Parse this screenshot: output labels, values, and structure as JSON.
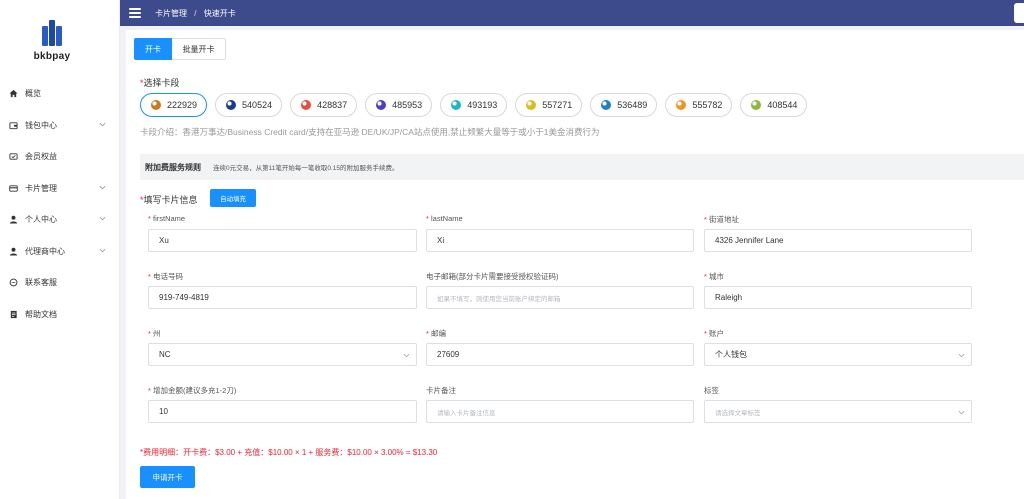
{
  "brand": {
    "logo_text": "bkbpay",
    "accent": "#1890ff",
    "topbar_color": "#3d4a8c"
  },
  "sidebar": {
    "items": [
      {
        "label": "概览",
        "icon": "home-icon",
        "has_submenu": false
      },
      {
        "label": "钱包中心",
        "icon": "wallet-icon",
        "has_submenu": true
      },
      {
        "label": "会员权益",
        "icon": "card-icon",
        "has_submenu": false
      },
      {
        "label": "卡片管理",
        "icon": "credit-card-icon",
        "has_submenu": true
      },
      {
        "label": "个人中心",
        "icon": "user-icon",
        "has_submenu": true
      },
      {
        "label": "代理商中心",
        "icon": "user-icon",
        "has_submenu": true
      },
      {
        "label": "联系客服",
        "icon": "chat-icon",
        "has_submenu": false
      },
      {
        "label": "帮助文档",
        "icon": "document-icon",
        "has_submenu": false
      }
    ]
  },
  "header": {
    "breadcrumb": [
      "卡片管理",
      "快速开卡"
    ],
    "breadcrumb_sep": "/"
  },
  "tabs": {
    "active": "开卡",
    "inactive": "批量开卡"
  },
  "bin_section": {
    "label": "选择卡段",
    "bins": [
      {
        "number": "222929",
        "icon_color": "#c87a1e",
        "selected": true
      },
      {
        "number": "540524",
        "icon_color": "#1e3a8a",
        "selected": false
      },
      {
        "number": "428837",
        "icon_color": "#e74c3c",
        "selected": false
      },
      {
        "number": "485953",
        "icon_color": "#4c3ccf",
        "selected": false
      },
      {
        "number": "493193",
        "icon_color": "#1fb5c9",
        "selected": false
      },
      {
        "number": "557271",
        "icon_color": "#e0b81f",
        "selected": false
      },
      {
        "number": "536489",
        "icon_color": "#1e7fc9",
        "selected": false
      },
      {
        "number": "555782",
        "icon_color": "#f0941f",
        "selected": false
      },
      {
        "number": "408544",
        "icon_color": "#8bb83a",
        "selected": false
      }
    ],
    "description": "卡段介绍：香港万事达/Business Credit card/支持在亚马逊 DE/UK/JP/CA站点使用,禁止频繁大量等于或小于1美金消费行为"
  },
  "rules": {
    "title": "附加费服务规则",
    "text": "连续0元交易，从第11笔开始每一笔收取0.15的附加服务手续费。"
  },
  "card_info": {
    "label": "填写卡片信息",
    "autofill_label": "自动填充"
  },
  "form": {
    "first_name": {
      "label": "firstName",
      "value": "Xu"
    },
    "last_name": {
      "label": "lastName",
      "value": "Xi"
    },
    "street": {
      "label": "街道地址",
      "value": "4326  Jennifer Lane"
    },
    "phone": {
      "label": "电话号码",
      "value": "919-749-4819"
    },
    "email": {
      "label": "电子邮箱(部分卡片需要接受授权验证码)",
      "placeholder": "如果不填写，则使用您当前账户绑定的邮箱"
    },
    "city": {
      "label": "城市",
      "value": "Raleigh"
    },
    "state": {
      "label": "州",
      "value": "NC"
    },
    "zip": {
      "label": "邮编",
      "value": "27609"
    },
    "account": {
      "label": "账户",
      "value": "个人钱包"
    },
    "amount": {
      "label": "增加金额(建议多充1-2刀)",
      "value": "10"
    },
    "note": {
      "label": "卡片备注",
      "placeholder": "请输入卡片备注信息"
    },
    "tags": {
      "label": "标签",
      "placeholder": "请选择文章标签"
    }
  },
  "fee_detail": "*费用明细：开卡费：$3.00 + 充值：$10.00 × 1 + 服务费：$10.00 × 3.00% = $13.30",
  "submit_label": "申请开卡"
}
